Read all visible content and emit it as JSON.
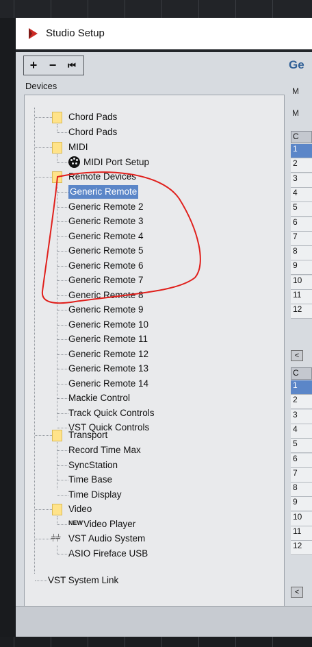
{
  "window": {
    "title": "Studio Setup"
  },
  "toolbar": {
    "add_label": "+",
    "remove_label": "−",
    "reset_label": "⏮"
  },
  "tree_header": "Devices",
  "tree": {
    "chord_pads_folder": "Chord Pads",
    "chord_pads_item": "Chord Pads",
    "midi_folder": "MIDI",
    "midi_port_setup": "MIDI Port Setup",
    "remote_devices_folder": "Remote Devices",
    "remote_items": [
      "Generic Remote",
      "Generic Remote 2",
      "Generic Remote 3",
      "Generic Remote 4",
      "Generic Remote 5",
      "Generic Remote 6",
      "Generic Remote 7",
      "Generic Remote 8",
      "Generic Remote 9",
      "Generic Remote 10",
      "Generic Remote 11",
      "Generic Remote 12",
      "Generic Remote 13",
      "Generic Remote 14",
      "Mackie Control",
      "Track Quick Controls",
      "VST Quick Controls"
    ],
    "transport_folder": "Transport",
    "transport_items": [
      "Record Time Max",
      "SyncStation",
      "Time Base",
      "Time Display"
    ],
    "video_folder": "Video",
    "video_player": "Video Player",
    "video_icon_text": "NEW",
    "vst_audio_system": "VST Audio System",
    "asio_device": "ASIO Fireface USB",
    "vst_system_link": "VST System Link",
    "selected_item": "Generic Remote"
  },
  "right_panel": {
    "title": "Ge",
    "label_1": "M",
    "label_2": "M",
    "table1_header": "C",
    "table1_rows": [
      "1",
      "2",
      "3",
      "4",
      "5",
      "6",
      "7",
      "8",
      "9",
      "10",
      "11",
      "12"
    ],
    "table2_header": "C",
    "table2_rows": [
      "1",
      "2",
      "3",
      "4",
      "5",
      "6",
      "7",
      "8",
      "9",
      "10",
      "11",
      "12"
    ],
    "scroll_left_glyph": "<"
  },
  "colors": {
    "selection": "#5b86c8",
    "folder": "#ffe38a",
    "title_accent": "#2f5f96",
    "annotation": "#e0201c"
  }
}
